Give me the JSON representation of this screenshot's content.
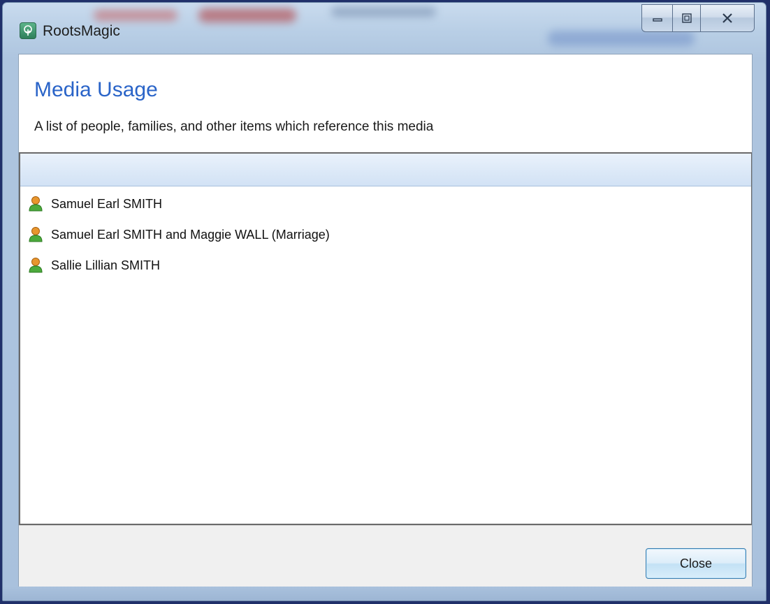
{
  "window": {
    "title": "RootsMagic",
    "app_icon": "rootsmagic-tree-icon",
    "caption_buttons": {
      "minimize": "minimize-icon",
      "maximize": "maximize-icon",
      "close": "close-icon"
    }
  },
  "dialog": {
    "title": "Media Usage",
    "subtitle": "A list of people, families, and other items which reference this media"
  },
  "list": {
    "header_text": "",
    "items": [
      {
        "label": "Samuel Earl SMITH",
        "icon": "person-icon"
      },
      {
        "label": "Samuel Earl SMITH and Maggie WALL (Marriage)",
        "icon": "person-icon"
      },
      {
        "label": "Sallie Lillian SMITH",
        "icon": "person-icon"
      }
    ]
  },
  "footer": {
    "close_label": "Close"
  },
  "colors": {
    "title_blue": "#2a64c8",
    "person_icon_orange": "#e8962e",
    "person_icon_green": "#4caa3c"
  }
}
